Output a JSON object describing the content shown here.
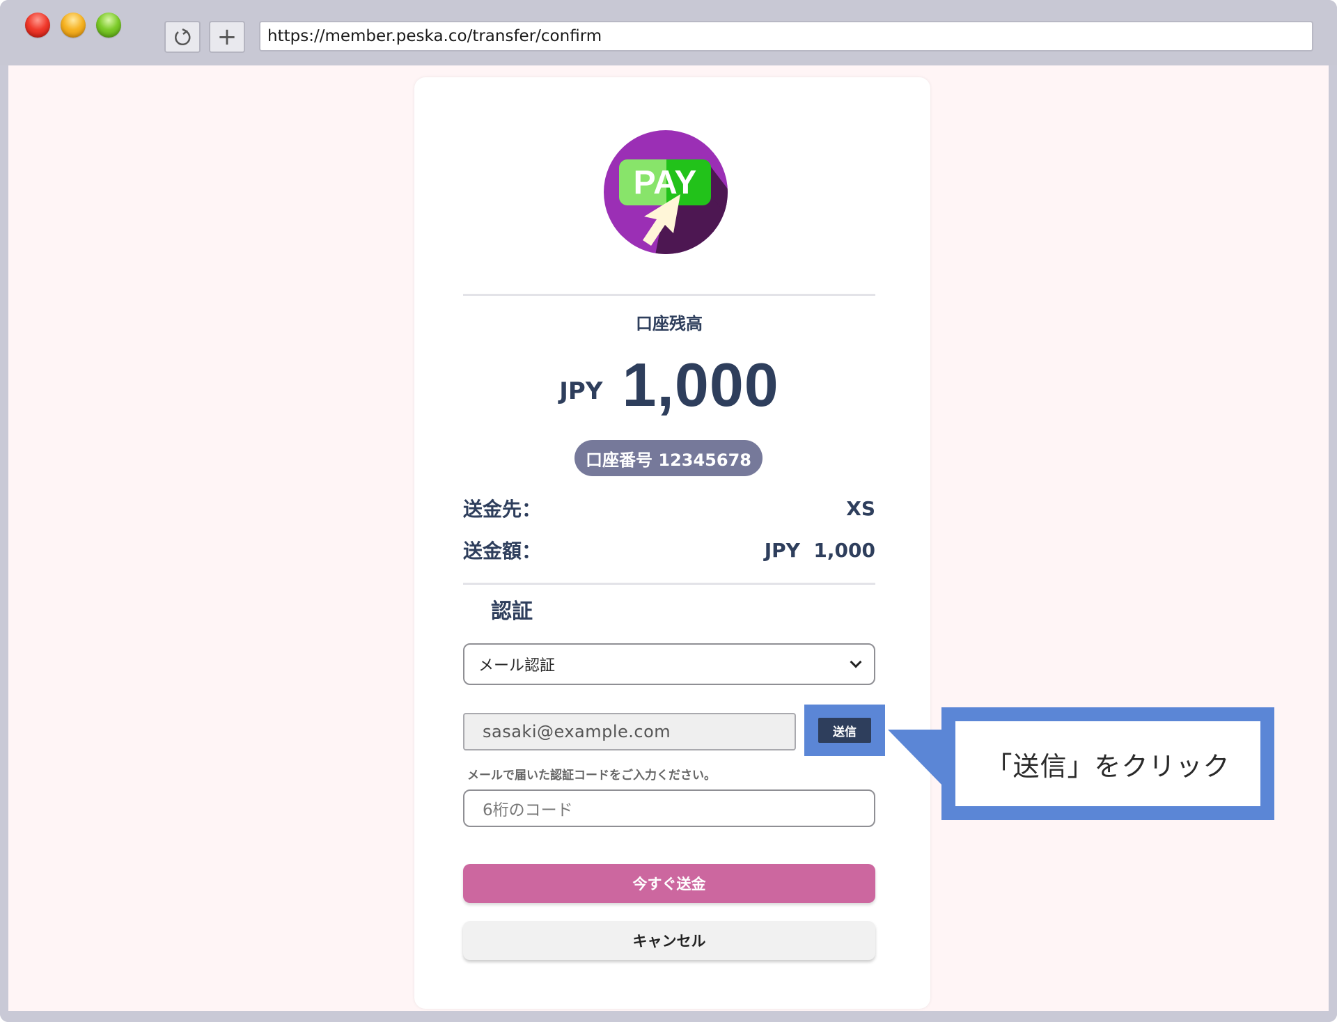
{
  "browser": {
    "url": "https://member.peska.co/transfer/confirm",
    "new_tab_label": "+"
  },
  "logo": {
    "text": "PAY",
    "colors": {
      "circle": "#9b2fb5",
      "shadow": "#4d1752",
      "badge_light": "#88e46a",
      "badge_dark": "#22c21a",
      "cursor": "#fff6d8"
    }
  },
  "balance": {
    "label": "口座残高",
    "currency": "JPY",
    "amount": "1,000"
  },
  "account": {
    "label": "口座番号 12345678"
  },
  "details": [
    {
      "label": "送金先：",
      "value": "XS"
    },
    {
      "label": "送金額：",
      "value": "JPY  1,000"
    }
  ],
  "auth": {
    "title": "認証",
    "method_selected": "メール認証",
    "email_value": "sasaki@example.com",
    "send_label": "送信",
    "hint": "メールで届いた認証コードをご入力ください。",
    "code_placeholder": "6桁のコード"
  },
  "actions": {
    "send_now": "今すぐ送金",
    "cancel": "キャンセル"
  },
  "callout": {
    "text": "「送信」をクリック",
    "color": "#5b86d6"
  }
}
